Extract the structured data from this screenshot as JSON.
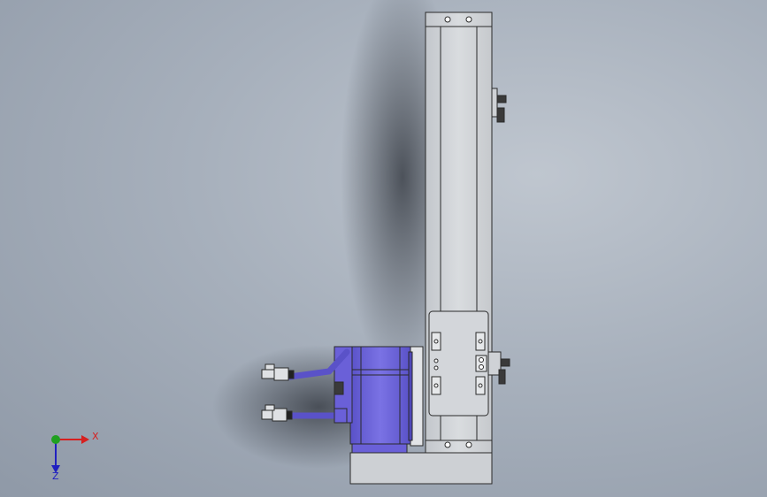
{
  "triad": {
    "x_label": "X",
    "z_label": "Z",
    "x_color": "#d62020",
    "y_color": "#20a020",
    "z_color": "#2020c0"
  },
  "model": {
    "rail_color": "#cdd0d4",
    "motor_color": "#6a60d8",
    "outline_color": "#2a2a2a",
    "background_color": "#a9b2be"
  }
}
